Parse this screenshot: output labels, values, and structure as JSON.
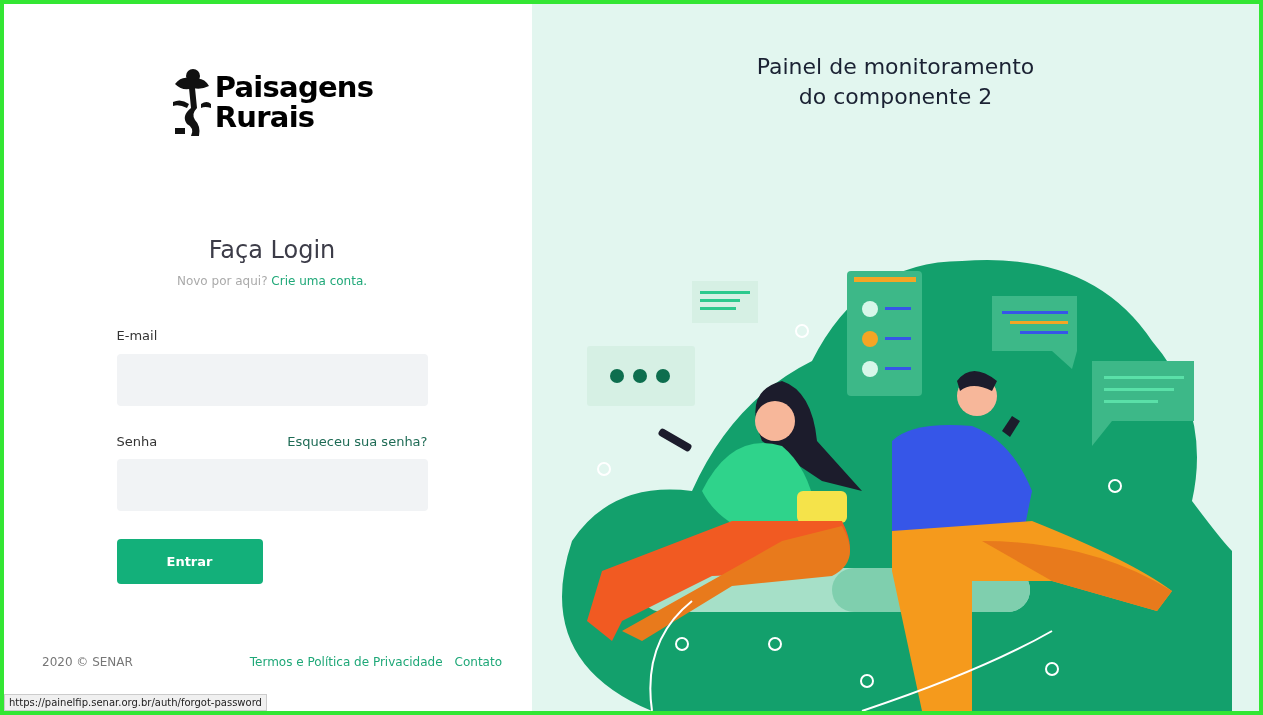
{
  "logo": {
    "line_1": "Paisagens",
    "line_2": "Rurais"
  },
  "login": {
    "heading": "Faça Login",
    "prompt": "Novo por aqui?",
    "signup_link": "Crie uma conta."
  },
  "fields": [
    {
      "label": "E-mail"
    },
    {
      "label": "Senha",
      "link": "Esqueceu sua senha?"
    }
  ],
  "submit": "Entrar",
  "footer": {
    "copyright": "2020 © SENAR",
    "links": [
      "Termos e Política de Privacidade",
      "Contato"
    ]
  },
  "status_url": "https://painelfip.senar.org.br/auth/forgot-password",
  "hero": {
    "title": "Painel de monitoramento do componente 2"
  }
}
